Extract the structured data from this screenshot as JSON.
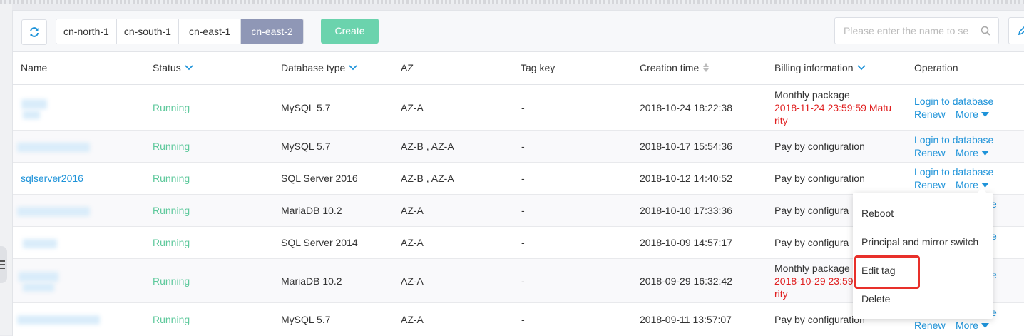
{
  "toolbar": {
    "regions": [
      "cn-north-1",
      "cn-south-1",
      "cn-east-1",
      "cn-east-2"
    ],
    "active_region": "cn-east-2",
    "create_label": "Create",
    "search_placeholder": "Please enter the name to se"
  },
  "table": {
    "headers": {
      "name": "Name",
      "status": "Status",
      "db_type": "Database type",
      "az": "AZ",
      "tag_key": "Tag key",
      "creation_time": "Creation time",
      "billing": "Billing information",
      "operation": "Operation"
    },
    "rows": [
      {
        "name": "",
        "status": "Running",
        "db_type": "MySQL 5.7",
        "az": "AZ-A",
        "tag": "-",
        "time": "2018-10-24 18:22:38",
        "billing": "Monthly package",
        "billing_red_1": "2018-11-24 23:59:59 Matu",
        "billing_red_2": "rity",
        "op_login": "Login to database",
        "op_renew": "Renew",
        "op_more": "More"
      },
      {
        "name": "",
        "status": "Running",
        "db_type": "MySQL 5.7",
        "az": "AZ-B , AZ-A",
        "tag": "-",
        "time": "2018-10-17 15:54:36",
        "billing": "Pay by configuration",
        "op_login": "Login to database",
        "op_renew": "Renew",
        "op_more": "More"
      },
      {
        "name": "sqlserver2016",
        "status": "Running",
        "db_type": "SQL Server 2016",
        "az": "AZ-B , AZ-A",
        "tag": "-",
        "time": "2018-10-12 14:40:52",
        "billing": "Pay by configuration",
        "op_login": "Login to database",
        "op_renew": "Renew",
        "op_more": "More"
      },
      {
        "name": "",
        "status": "Running",
        "db_type": "MariaDB 10.2",
        "az": "AZ-A",
        "tag": "-",
        "time": "2018-10-10 17:33:36",
        "billing": "Pay by configura",
        "op_tail": "e"
      },
      {
        "name": "",
        "status": "Running",
        "db_type": "SQL Server 2014",
        "az": "AZ-A",
        "tag": "-",
        "time": "2018-10-09 14:57:17",
        "billing": "Pay by configura",
        "op_tail": "e"
      },
      {
        "name": "",
        "status": "Running",
        "db_type": "MariaDB 10.2",
        "az": "AZ-A",
        "tag": "-",
        "time": "2018-09-29 16:32:42",
        "billing": "Monthly package",
        "billing_red_1": "2018-10-29 23:59",
        "billing_red_2": "rity",
        "op_tail": "e"
      },
      {
        "name": "",
        "status": "Running",
        "db_type": "MySQL 5.7",
        "az": "AZ-A",
        "tag": "-",
        "time": "2018-09-11 13:57:07",
        "billing": "Pay by configuration",
        "op_renew": "Renew",
        "op_more": "More",
        "op_tail": "e"
      }
    ]
  },
  "more_menu": {
    "items": [
      "Reboot",
      "Principal and mirror switch",
      "Edit tag",
      "Delete"
    ]
  },
  "colors": {
    "accent": "#1e93d9",
    "status_running": "#5ec99c",
    "create_button": "#6bd3ad",
    "active_region": "#8f97b6",
    "expiry_red": "#e02020",
    "highlight": "#e8302a"
  }
}
